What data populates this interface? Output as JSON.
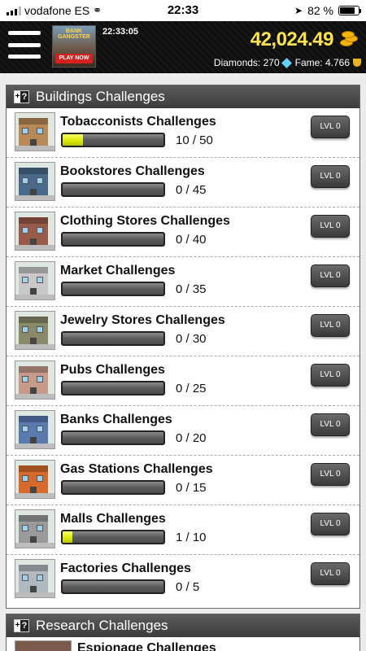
{
  "status_bar": {
    "carrier": "vodafone ES",
    "time": "22:33",
    "battery_percent": "82 %",
    "battery_level": 0.82
  },
  "header": {
    "ad_title": "BANK GANGSTER",
    "ad_cta": "PLAY NOW",
    "game_time": "22:33:05",
    "money": "42,024.49",
    "diamonds_label": "Diamonds: 270",
    "fame_label": "Fame: 4.766"
  },
  "buildings_panel": {
    "title": "Buildings Challenges",
    "help_plus": "+",
    "help_q": "?",
    "items": [
      {
        "title": "Tobacconists Challenges",
        "progress": "10 / 50",
        "fraction": 0.2,
        "level": "LVL 0",
        "color": "#b88a5a"
      },
      {
        "title": "Bookstores Challenges",
        "progress": "0 / 45",
        "fraction": 0,
        "level": "LVL 0",
        "color": "#4a6a8a"
      },
      {
        "title": "Clothing Stores Challenges",
        "progress": "0 / 40",
        "fraction": 0,
        "level": "LVL 0",
        "color": "#9a5a4a"
      },
      {
        "title": "Market Challenges",
        "progress": "0 / 35",
        "fraction": 0,
        "level": "LVL 0",
        "color": "#c8c8c8"
      },
      {
        "title": "Jewelry Stores Challenges",
        "progress": "0 / 30",
        "fraction": 0,
        "level": "LVL 0",
        "color": "#8a8a6a"
      },
      {
        "title": "Pubs Challenges",
        "progress": "0 / 25",
        "fraction": 0,
        "level": "LVL 0",
        "color": "#c89a8a"
      },
      {
        "title": "Banks Challenges",
        "progress": "0 / 20",
        "fraction": 0,
        "level": "LVL 0",
        "color": "#5a7ab0"
      },
      {
        "title": "Gas Stations Challenges",
        "progress": "0 / 15",
        "fraction": 0,
        "level": "LVL 0",
        "color": "#d66a2a"
      },
      {
        "title": "Malls Challenges",
        "progress": "1 / 10",
        "fraction": 0.1,
        "level": "LVL 0",
        "color": "#9a9a9a"
      },
      {
        "title": "Factories Challenges",
        "progress": "0 / 5",
        "fraction": 0,
        "level": "LVL 0",
        "color": "#b0b8c0"
      }
    ]
  },
  "research_panel": {
    "title": "Research Challenges",
    "help_plus": "+",
    "help_q": "?",
    "first_item": "Espionage Challenges"
  }
}
